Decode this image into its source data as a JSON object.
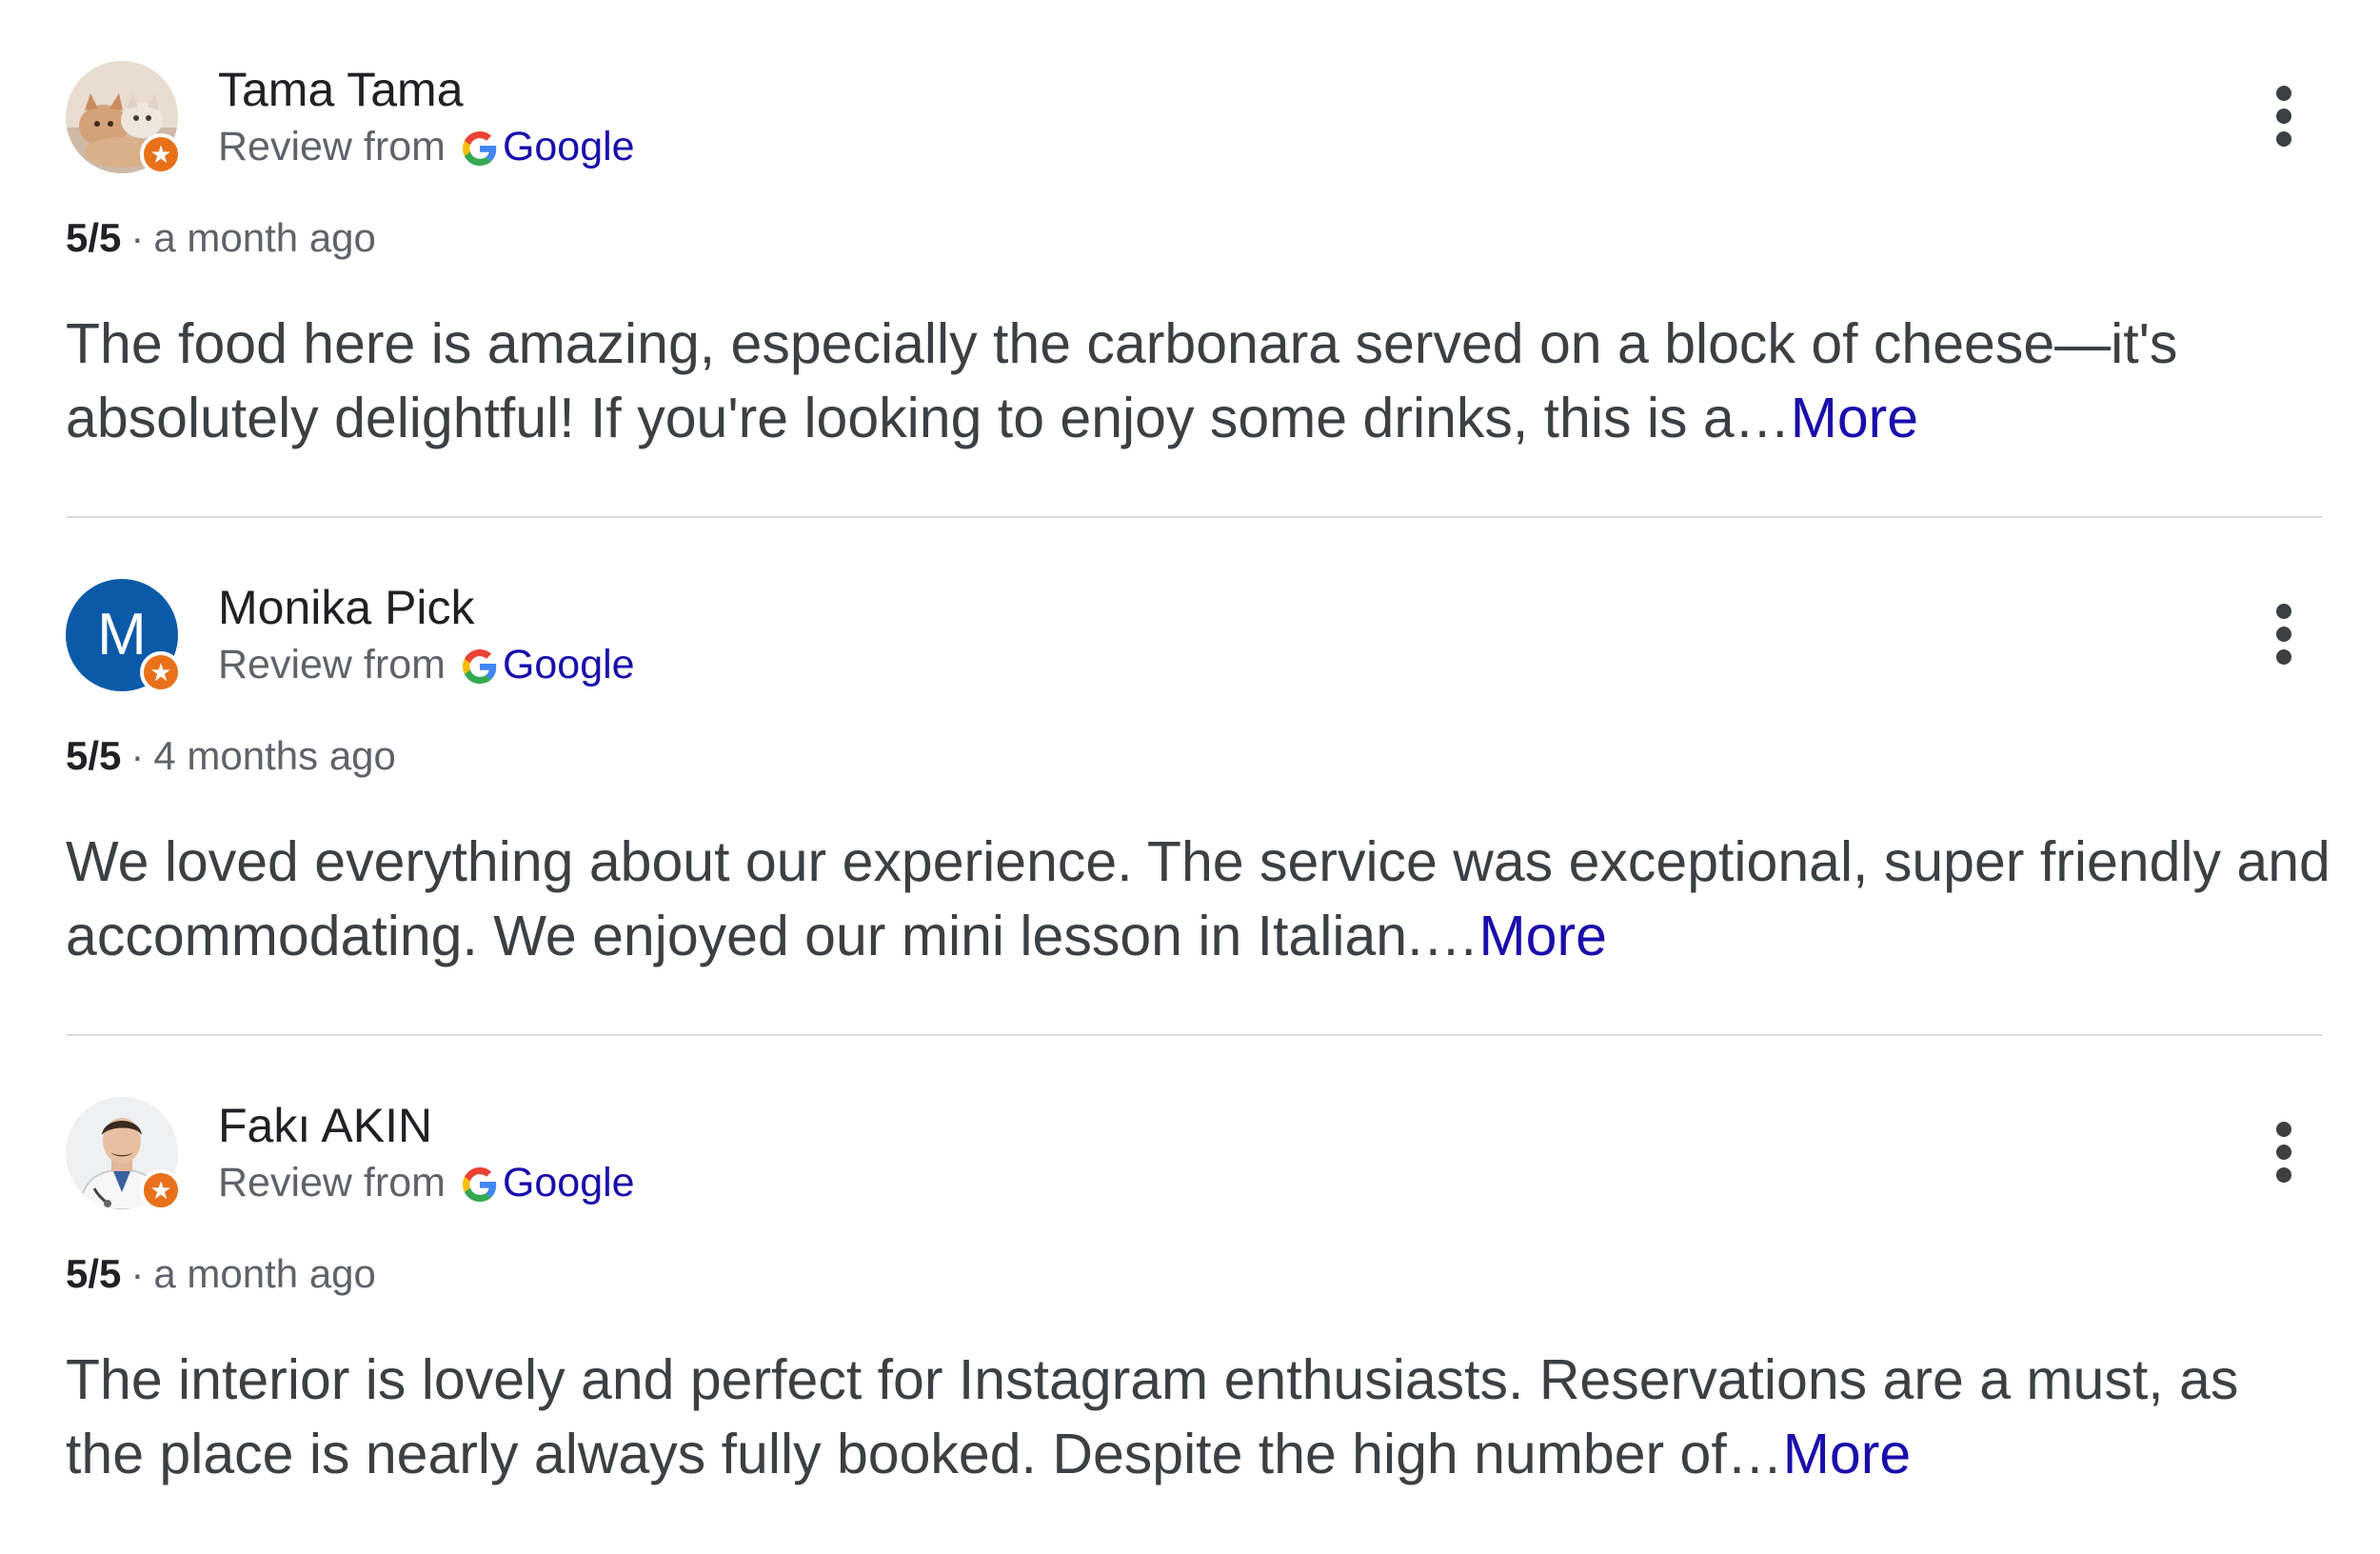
{
  "reviews": [
    {
      "author": "Tama Tama",
      "avatar_type": "photo-cats",
      "source_prefix": "Review from",
      "source_name": "Google",
      "rating": "5/5",
      "separator": "·",
      "time": "a month ago",
      "text": "The food here is amazing, especially the carbonara served on a block of cheese—it's absolutely delightful! If you're looking to enjoy some drinks, this is a…",
      "more_label": "More"
    },
    {
      "author": "Monika Pick",
      "avatar_type": "letter",
      "avatar_letter": "M",
      "avatar_color": "#0b5aa8",
      "source_prefix": "Review from",
      "source_name": "Google",
      "rating": "5/5",
      "separator": "·",
      "time": "4 months ago",
      "text": "We loved everything about our experience. The service was exceptional, super friendly and accommodating. We enjoyed our mini lesson in Italian.…",
      "more_label": "More"
    },
    {
      "author": "Fakı AKIN",
      "avatar_type": "photo-person",
      "source_prefix": "Review from",
      "source_name": "Google",
      "rating": "5/5",
      "separator": "·",
      "time": "a month ago",
      "text": "The interior is lovely and perfect for Instagram enthusiasts. Reservations are a must, as the place is nearly always fully booked. Despite the high number of…",
      "more_label": "More"
    }
  ],
  "colors": {
    "link": "#1a0dab",
    "local_guide_badge": "#e8711a",
    "divider": "#dadce0"
  },
  "icons": {
    "menu": "more-vert-icon",
    "source": "google-g-icon",
    "badge": "local-guide-star-icon"
  }
}
